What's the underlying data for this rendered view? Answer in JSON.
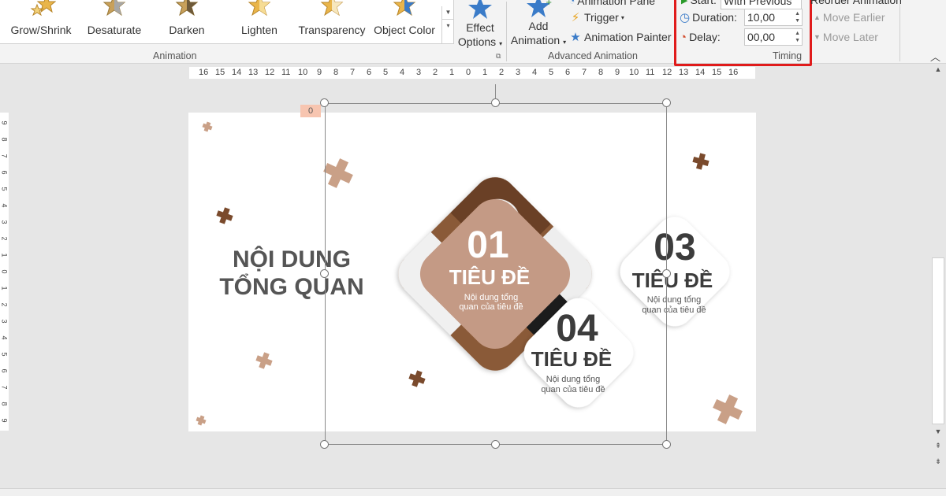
{
  "ribbon": {
    "animation_gallery": [
      {
        "label": "Grow/Shrink",
        "icon": "grow-shrink-star-icon"
      },
      {
        "label": "Desaturate",
        "icon": "desaturate-star-icon"
      },
      {
        "label": "Darken",
        "icon": "darken-star-icon"
      },
      {
        "label": "Lighten",
        "icon": "lighten-star-icon"
      },
      {
        "label": "Transparency",
        "icon": "transparency-star-icon"
      },
      {
        "label": "Object Color",
        "icon": "object-color-star-icon"
      }
    ],
    "effect_options": {
      "line1": "Effect",
      "line2": "Options"
    },
    "animation_group_label": "Animation",
    "add_animation": {
      "line1": "Add",
      "line2": "Animation"
    },
    "animation_pane": "Animation Pane",
    "trigger": "Trigger",
    "animation_painter": "Animation Painter",
    "advanced_group_label": "Advanced Animation",
    "start_label": "Start:",
    "start_value": "With Previous",
    "duration_label": "Duration:",
    "duration_value": "10,00",
    "delay_label": "Delay:",
    "delay_value": "00,00",
    "timing_group_label": "Timing",
    "reorder_label": "Reorder Animation",
    "move_earlier": "Move Earlier",
    "move_later": "Move Later"
  },
  "ruler": {
    "horizontal_ticks": [
      "16",
      "15",
      "14",
      "13",
      "12",
      "11",
      "10",
      "9",
      "8",
      "7",
      "6",
      "5",
      "4",
      "3",
      "2",
      "1",
      "0",
      "1",
      "2",
      "3",
      "4",
      "5",
      "6",
      "7",
      "8",
      "9",
      "10",
      "11",
      "12",
      "13",
      "14",
      "15",
      "16"
    ],
    "vertical_ticks": [
      "9",
      "8",
      "7",
      "6",
      "5",
      "4",
      "3",
      "2",
      "1",
      "0",
      "1",
      "2",
      "3",
      "4",
      "5",
      "6",
      "7",
      "8",
      "9"
    ]
  },
  "slide": {
    "animation_tag": "0",
    "headline_line1": "NỘI DUNG",
    "headline_line2": "TỔNG QUAN",
    "card_01": {
      "number": "01",
      "title": "TIÊU ĐỀ",
      "desc1": "Nội dung tổng",
      "desc2": "quan của tiêu đề"
    },
    "card_03": {
      "number": "03",
      "title": "TIÊU ĐỀ",
      "desc1": "Nội dung tổng",
      "desc2": "quan của tiêu đề"
    },
    "card_04": {
      "number": "04",
      "title": "TIÊU ĐỀ",
      "desc1": "Nội dung tổng",
      "desc2": "quan của tiêu đề"
    }
  },
  "colors": {
    "accent_tan": "#c49a85",
    "dark_brown": "#7a4a2c",
    "light_tan": "#c9a087",
    "highlight_red": "#e01b1b",
    "star_blue": "#3a7bc8"
  }
}
